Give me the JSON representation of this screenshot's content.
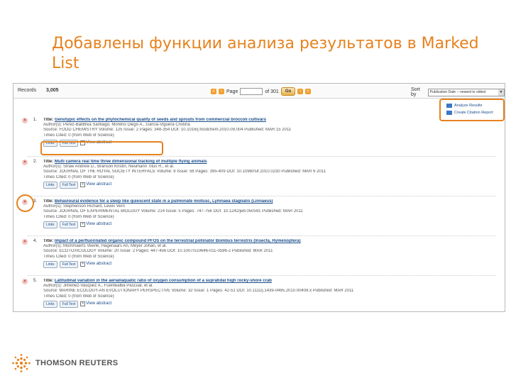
{
  "slide": {
    "title": "Добавлены функции анализа результатов в Marked List",
    "brand": "THOMSON REUTERS",
    "accent_color": "#e6821e"
  },
  "topbar": {
    "records_label": "Records",
    "records_count": "3,005",
    "page_label": "Page",
    "page_of": "of 301",
    "go_label": "Go",
    "sort_label": "Sort by",
    "sort_value": "Publication Date -- newest to oldest"
  },
  "tools": {
    "analyze": "Analyze Results",
    "citation": "Create Citation Report"
  },
  "record_buttons": {
    "links": "Links",
    "full_text": "Full Text",
    "view_abstract": "View abstract"
  },
  "records": [
    {
      "num": "1.",
      "title": "Genotypic effects on the phytochemical quality of seeds and sprouts from commercial broccoli cultivars",
      "authors": "Author(s): Perez-Balibrea Santiago, Moreno Diego A., Garcia-Viguera Cristina",
      "source": "Source: FOOD CHEMISTRY Volume: 125 Issue: 2 Pages: 348-354 DOI: 10.1016/j.foodchem.2010.09.004 Published: MAR 15 2011",
      "cited": "Times Cited: 0 (from Web of Science)"
    },
    {
      "num": "2.",
      "title": "Multi camera real time three dimensional tracking of multiple flying animals",
      "authors": "Author(s): Straw Andrew D., Branson Kristin, Neumann Titus R., et al.",
      "source": "Source: JOURNAL OF THE ROYAL SOCIETY INTERFACE Volume: 8 Issue: 56 Pages: 395-409 DOI: 10.1098/rsif.2010.0230 Published: MAR 6 2011",
      "cited": "Times Cited: 0 (from Web of Science)"
    },
    {
      "num": "3.",
      "title": "Behavioural evidence for a sleep like quiescent state in a pulmonate mollusc, Lymnaea stagnalis (Linnaeus)",
      "authors": "Author(s): Stephenson Richard, Lewis Vern",
      "source": "Source: JOURNAL OF EXPERIMENTAL BIOLOGY Volume: 214 Issue: 5 Pages: 747-756 DOI: 10.1242/jeb.050591 Published: MAR 2011",
      "cited": "Times Cited: 0 (from Web of Science)"
    },
    {
      "num": "4.",
      "title": "Impact of a perfluorinated organic compound PFOS on the terrestrial pollinator Bombus terrestris (Insecta, Hymenoptera)",
      "authors": "Author(s): Mommaerts Veerle, Hagenaars An, Meyer Johan, et al.",
      "source": "Source: ECOTOXICOLOGY Volume: 20 Issue: 2 Pages: 447-456 DOI: 10.1007/s10646-011-0596-2 Published: MAR 2011",
      "cited": "Times Cited: 0 (from Web of Science)"
    },
    {
      "num": "5.",
      "title": "Latitudinal variation in the aerial/aquatic ratio of oxygen consumption of a supratidal high rocky-shore crab",
      "authors": "Author(s): Jimenez-Vasquez A., Fuentealba Pascual, et al.",
      "source": "Source: MARINE ECOLOGY-AN EVOLUTIONARY PERSPECTIVE Volume: 32 Issue: 1 Pages: 42-51 DOI: 10.1111/j.1439-0485.2010.00408.x Published: MAR 2011",
      "cited": "Times Cited: 0 (from Web of Science)"
    }
  ]
}
